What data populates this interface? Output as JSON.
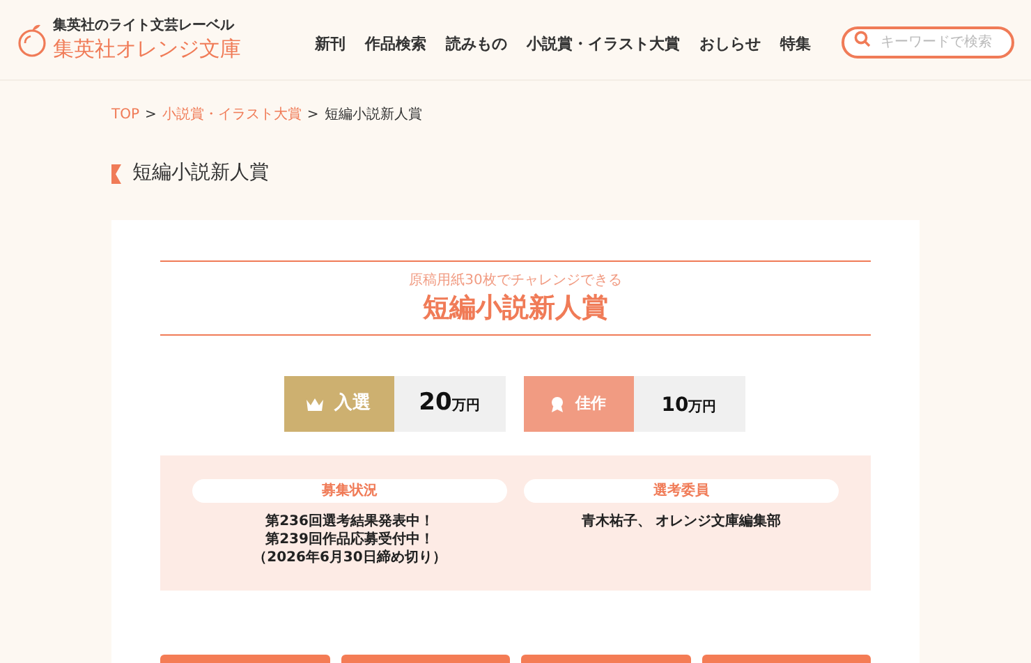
{
  "header": {
    "tagline": "集英社のライト文芸レーベル",
    "logo_text": "集英社オレンジ文庫",
    "nav": [
      "新刊",
      "作品検索",
      "読みもの",
      "小説賞・イラスト大賞",
      "おしらせ",
      "特集"
    ],
    "search": {
      "placeholder": "キーワードで検索"
    }
  },
  "breadcrumb": [
    {
      "label": "TOP",
      "link": true
    },
    {
      "label": "小説賞・イラスト大賞",
      "link": true
    },
    {
      "label": "短編小説新人賞",
      "link": false
    }
  ],
  "breadcrumb_separator": ">",
  "page_title": "短編小説新人賞",
  "award": {
    "subtitle": "原稿用紙30枚でチャレンジできる",
    "title": "短編小説新人賞",
    "prizes": [
      {
        "kind": "crown",
        "label": "入選",
        "amount": "20",
        "unit": "万円",
        "color": "#cdb070"
      },
      {
        "kind": "ribbon",
        "label": "佳作",
        "amount": "10",
        "unit": "万円",
        "color": "#f19b82"
      }
    ],
    "info": [
      {
        "heading": "募集状況",
        "lines": [
          "第236回選考結果発表中！",
          "第239回作品応募受付中！",
          "（2026年6月30日締め切り）"
        ]
      },
      {
        "heading": "選考委員",
        "lines": [
          "青木祐子、 オレンジ文庫編集部"
        ]
      }
    ]
  }
}
